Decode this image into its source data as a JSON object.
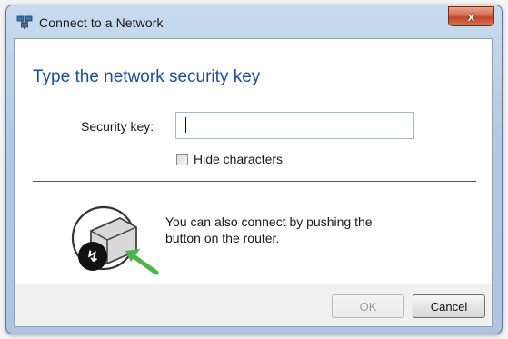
{
  "window": {
    "title": "Connect to a Network",
    "title_icon": "network-icon",
    "close_label": "x"
  },
  "dialog": {
    "heading": "Type the network security key",
    "security_key_label": "Security key:",
    "security_key_value": "",
    "hide_characters_label": "Hide characters",
    "hide_characters_checked": false,
    "push_button_text_line1": "You can also connect by pushing the",
    "push_button_text_line2": "button on the router.",
    "router_icon": "router-push-button-icon"
  },
  "buttons": {
    "ok_label": "OK",
    "ok_enabled": false,
    "cancel_label": "Cancel"
  },
  "colors": {
    "heading": "#1f4e99",
    "close_button": "#c2452a",
    "frame": "#b3c9e3",
    "arrow_green": "#4bb34b"
  }
}
